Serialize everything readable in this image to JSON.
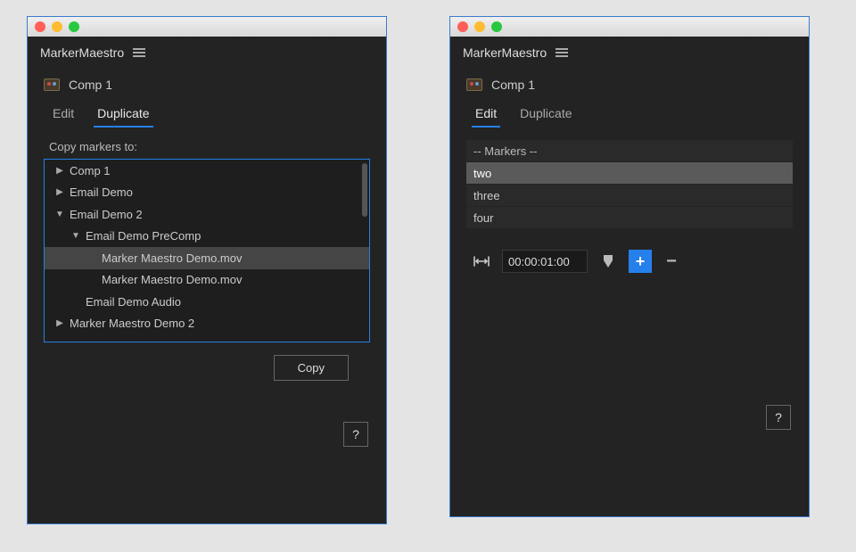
{
  "left": {
    "title": "MarkerMaestro",
    "comp": "Comp 1",
    "tabs": {
      "edit": "Edit",
      "duplicate": "Duplicate",
      "active": "duplicate"
    },
    "section_label": "Copy markers to:",
    "tree": [
      {
        "label": "Comp 1",
        "indent": 0,
        "toggle": "right"
      },
      {
        "label": "Email Demo",
        "indent": 0,
        "toggle": "right"
      },
      {
        "label": "Email Demo 2",
        "indent": 0,
        "toggle": "down"
      },
      {
        "label": "Email Demo PreComp",
        "indent": 1,
        "toggle": "down"
      },
      {
        "label": "Marker Maestro Demo.mov",
        "indent": 2,
        "toggle": "",
        "selected": true
      },
      {
        "label": "Marker Maestro Demo.mov",
        "indent": 2,
        "toggle": ""
      },
      {
        "label": "Email Demo Audio",
        "indent": 1,
        "toggle": ""
      },
      {
        "label": "Marker Maestro Demo 2",
        "indent": 0,
        "toggle": "right"
      }
    ],
    "copy_label": "Copy",
    "help_label": "?"
  },
  "right": {
    "title": "MarkerMaestro",
    "comp": "Comp 1",
    "tabs": {
      "edit": "Edit",
      "duplicate": "Duplicate",
      "active": "edit"
    },
    "markers_header": "-- Markers --",
    "markers": [
      {
        "label": "two",
        "selected": true
      },
      {
        "label": "three"
      },
      {
        "label": "four"
      }
    ],
    "timecode": "00:00:01:00",
    "help_label": "?"
  }
}
